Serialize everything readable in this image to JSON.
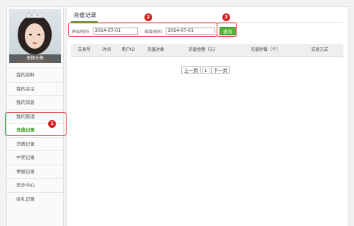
{
  "sidebar": {
    "avatar_caption": "更换头像",
    "items": [
      {
        "label": "我的资料"
      },
      {
        "label": "我的关注"
      },
      {
        "label": "我的消息"
      },
      {
        "label": "我的管理"
      },
      {
        "label": "充值记录"
      },
      {
        "label": "消费记录"
      },
      {
        "label": "中奖记录"
      },
      {
        "label": "举报记录"
      },
      {
        "label": "安全中心"
      },
      {
        "label": "收礼记录"
      }
    ],
    "active_index": 4
  },
  "main": {
    "title": "充值记录",
    "filter": {
      "start_label": "开始时间:",
      "start_value": "2014-07-01",
      "end_label": "结束时间:",
      "end_value": "2014-07-01",
      "query_label": "查询"
    },
    "table": {
      "columns": [
        "交易号",
        "时间",
        "用户ID",
        "充值对象",
        "充值金额（元）",
        "充值秒餐（个）",
        "交易方式"
      ]
    },
    "pager": {
      "prev_label": "上一页",
      "current_page": "1",
      "next_label": "下一页"
    }
  },
  "annotations": {
    "badge_1": "1",
    "badge_2": "2",
    "badge_3": "3",
    "highlight_color": "#e03333"
  },
  "colors": {
    "accent_green": "#52b236",
    "active_text": "#3a9b1e"
  }
}
